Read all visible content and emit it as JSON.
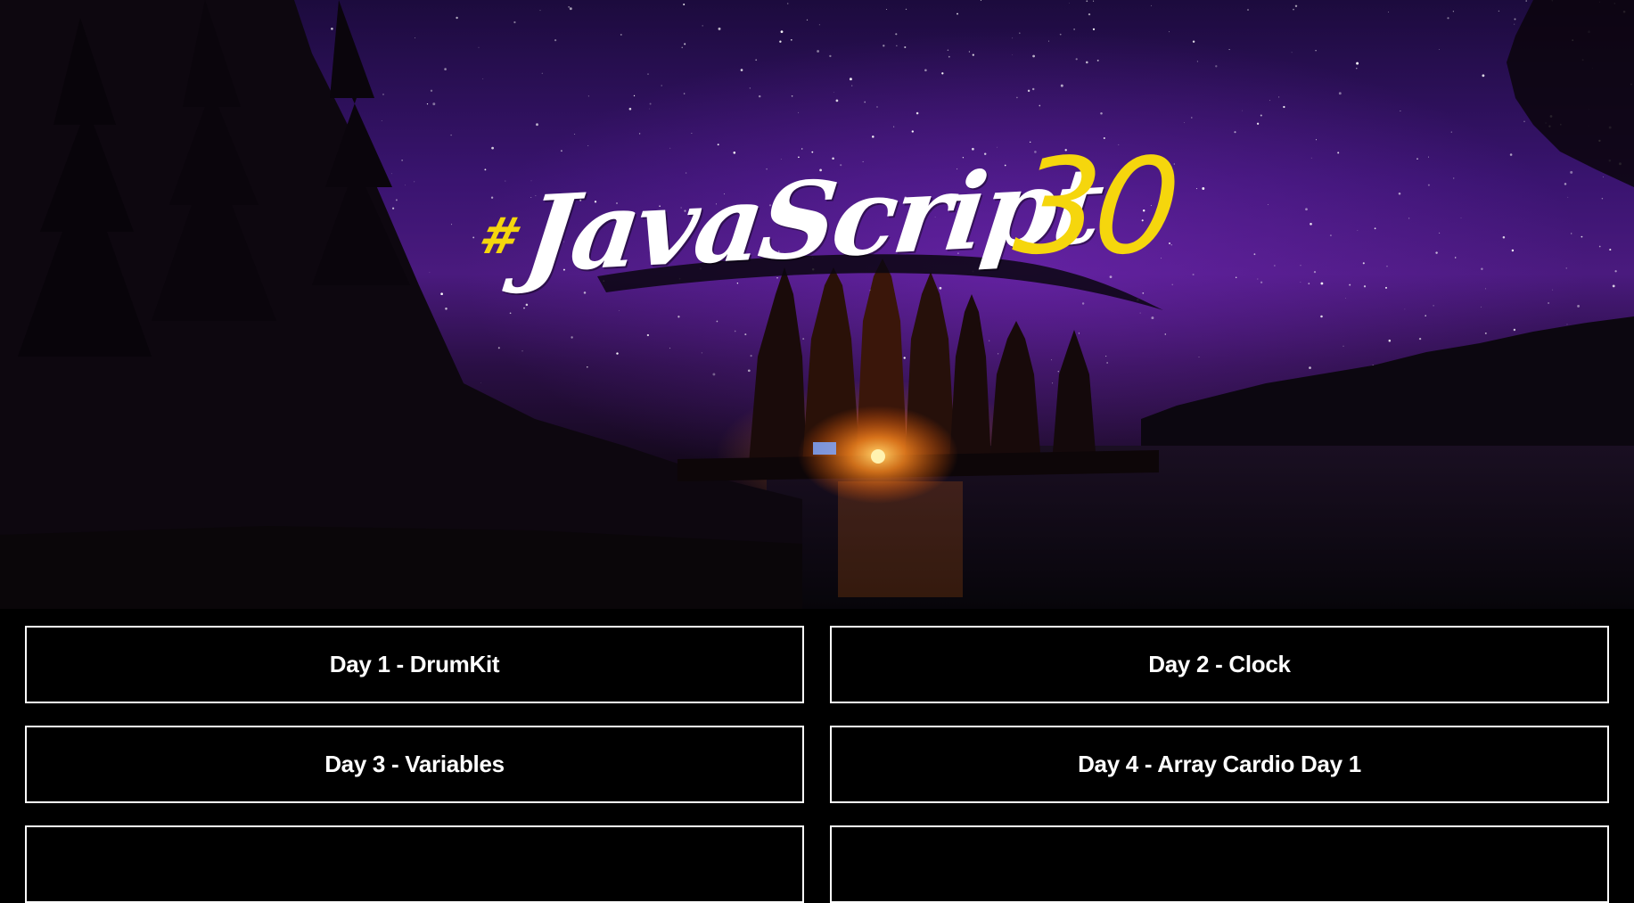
{
  "hero": {
    "logo": {
      "hash": "#",
      "word": "JavaScript",
      "number": "30"
    }
  },
  "days": [
    {
      "label": "Day 1 - DrumKit"
    },
    {
      "label": "Day 2 - Clock"
    },
    {
      "label": "Day 3 - Variables"
    },
    {
      "label": "Day 4 - Array Cardio Day 1"
    },
    {
      "label": ""
    },
    {
      "label": ""
    }
  ],
  "colors": {
    "accent": "#f5d60d",
    "background": "#000000",
    "card_border": "#ffffff",
    "text": "#ffffff"
  }
}
